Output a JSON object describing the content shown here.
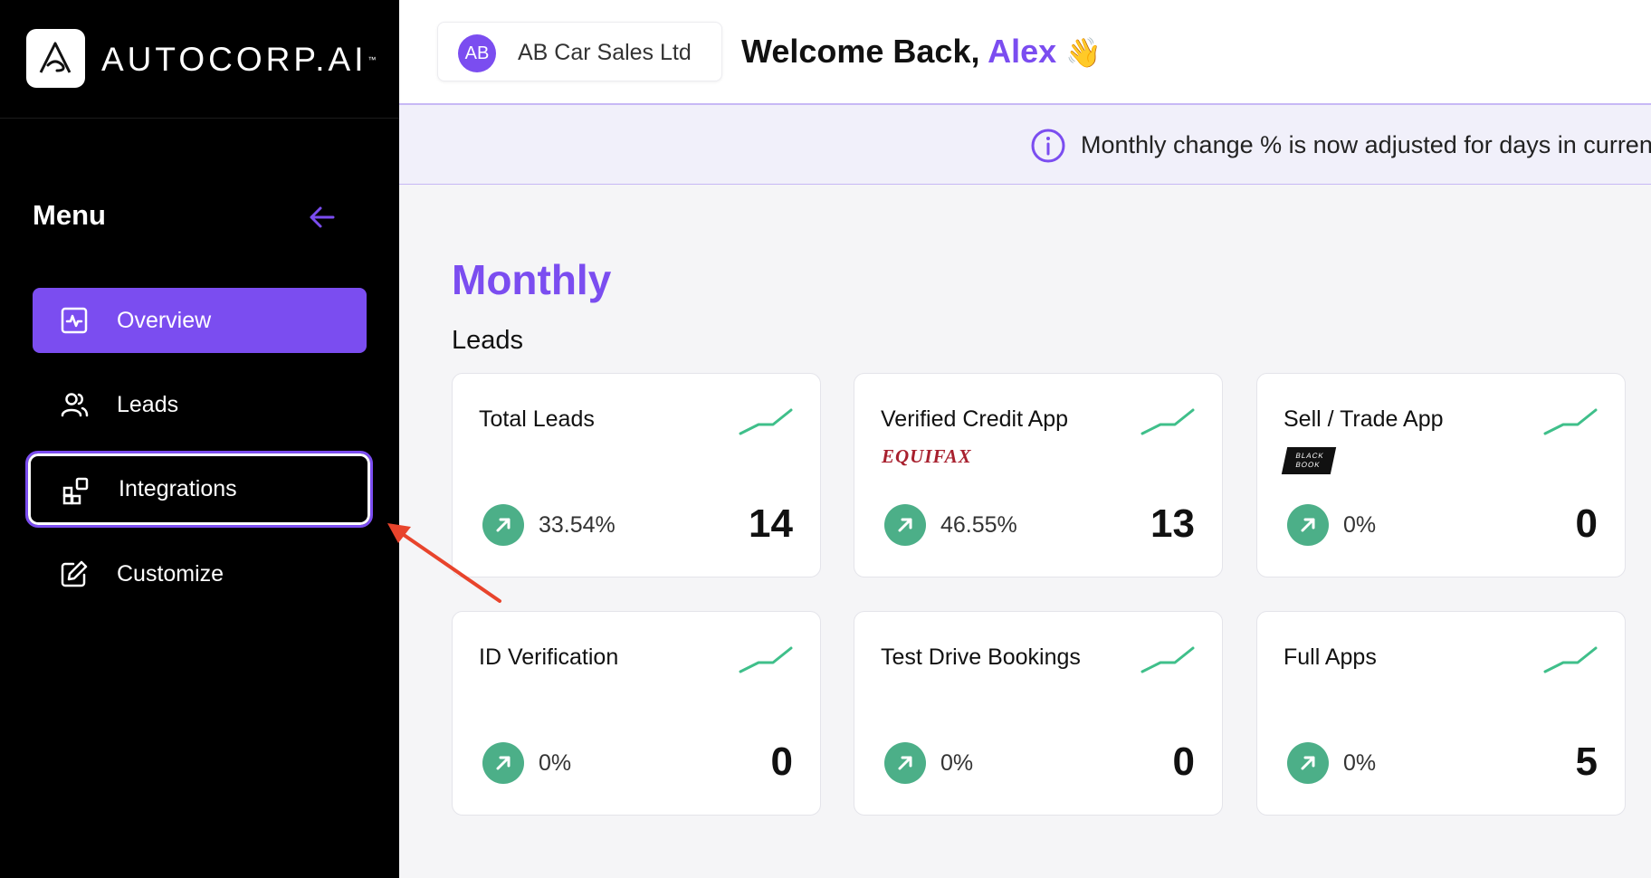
{
  "brand": {
    "name": "AUTOCORP.AI",
    "tm": "™"
  },
  "sidebar": {
    "menu_title": "Menu",
    "items": [
      {
        "label": "Overview",
        "icon": "activity-icon",
        "active": true
      },
      {
        "label": "Leads",
        "icon": "users-icon"
      },
      {
        "label": "Integrations",
        "icon": "integrations-icon",
        "focused": true
      },
      {
        "label": "Customize",
        "icon": "edit-icon"
      }
    ]
  },
  "header": {
    "company_initials": "AB",
    "company_name": "AB Car Sales Ltd",
    "welcome_prefix": "Welcome Back, ",
    "user_name": "Alex",
    "wave_icon": "wave-hand-icon"
  },
  "banner": {
    "text": "Monthly change % is now adjusted for days in current month"
  },
  "section": {
    "title": "Monthly",
    "subtitle": "Leads",
    "cards": [
      {
        "title": "Total Leads",
        "change": "33.54%",
        "value": "14"
      },
      {
        "title": "Verified Credit App",
        "brand": "EQUIFAX",
        "change": "46.55%",
        "value": "13"
      },
      {
        "title": "Sell / Trade App",
        "brand": "BLACK BOOK",
        "change": "0%",
        "value": "0"
      },
      {
        "title": "ID Verification",
        "change": "0%",
        "value": "0"
      },
      {
        "title": "Test Drive Bookings",
        "change": "0%",
        "value": "0"
      },
      {
        "title": "Full Apps",
        "change": "0%",
        "value": "5"
      }
    ]
  },
  "colors": {
    "accent": "#7b4df0",
    "positive": "#4caf88",
    "annotation": "#e8442c"
  }
}
